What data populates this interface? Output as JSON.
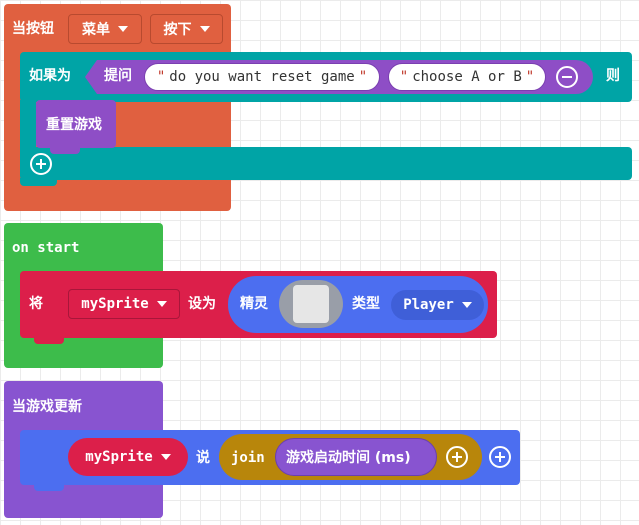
{
  "block_button": {
    "label": "当按钮",
    "button_value": "菜单",
    "event_value": "按下"
  },
  "if_block": {
    "label": "如果为",
    "ask_label": "提问",
    "string1": "do you want reset game",
    "string2": "choose A or B",
    "then_label": "则",
    "reset_label": "重置游戏"
  },
  "on_start": {
    "label": "on start",
    "set_label": "将",
    "variable": "mySprite",
    "assign_label": "设为",
    "sprite_label": "精灵",
    "kind_label": "类型",
    "kind_value": "Player"
  },
  "game_update": {
    "label": "当游戏更新",
    "variable": "mySprite",
    "say_label": "说",
    "join_label": "join",
    "time_label": "游戏启动时间 (ms)"
  },
  "colors": {
    "event_orange": "#e06040",
    "logic_teal": "#00a4a6",
    "ask_purple": "#8e4ec6",
    "loops_green": "#3dbc4b",
    "sprite_red": "#dc1f4a",
    "sprite_blue": "#4c6ef0",
    "text_gold": "#b8860b",
    "game_purple": "#8854d0"
  }
}
